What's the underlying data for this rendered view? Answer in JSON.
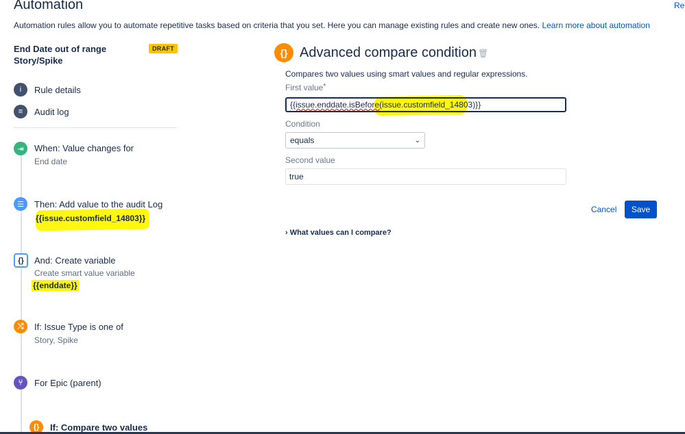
{
  "header": {
    "title": "Automation",
    "top_right_link": "Ref",
    "intro_text": "Automation rules allow you to automate repetitive tasks based on criteria that you set. Here you can manage existing rules and create new ones.",
    "intro_link": "Learn more about automation"
  },
  "rule": {
    "name_line1": "End Date out of range",
    "name_line2": "Story/Spike",
    "badge": "DRAFT"
  },
  "nav": {
    "rule_details": "Rule details",
    "audit_log": "Audit log"
  },
  "steps": [
    {
      "title": "When: Value changes for",
      "subtitle": "End date",
      "icon": "trigger-icon",
      "color": "#36b37e"
    },
    {
      "title": "Then: Add value to the audit Log",
      "value": "{{issue.customfield_14803}}",
      "icon": "log-icon",
      "color": "#4c9aff"
    },
    {
      "title": "And: Create variable",
      "subtitle": "Create smart value variable",
      "value": "{{enddate}}",
      "icon": "variable-icon",
      "color": "#4c9aff"
    },
    {
      "title": "If: Issue Type is one of",
      "subtitle": "Story, Spike",
      "icon": "shuffle-icon",
      "color": "#ff8b00"
    },
    {
      "title": "For Epic (parent)",
      "icon": "branch-icon",
      "color": "#6554c0"
    },
    {
      "title": "If: Compare two values",
      "icon": "compare-icon",
      "color": "#ff8b00"
    }
  ],
  "condition": {
    "title": "Advanced compare condition",
    "description": "Compares two values using smart values and regular expressions.",
    "first_value_label": "First value",
    "required_mark": "*",
    "first_value_part1": "{{issue.enddate.isBefore(",
    "first_value_part2": "issue.customfield_14803",
    "first_value_part3": ")}}",
    "condition_label": "Condition",
    "condition_selected": "equals",
    "second_value_label": "Second value",
    "second_value": "true",
    "cancel_label": "Cancel",
    "save_label": "Save",
    "help_toggle": "What values can I compare?"
  },
  "colors": {
    "accent": "#0052cc",
    "highlight": "#fff700",
    "draft": "#ffc400",
    "condition_icon": "#ff8b00"
  }
}
